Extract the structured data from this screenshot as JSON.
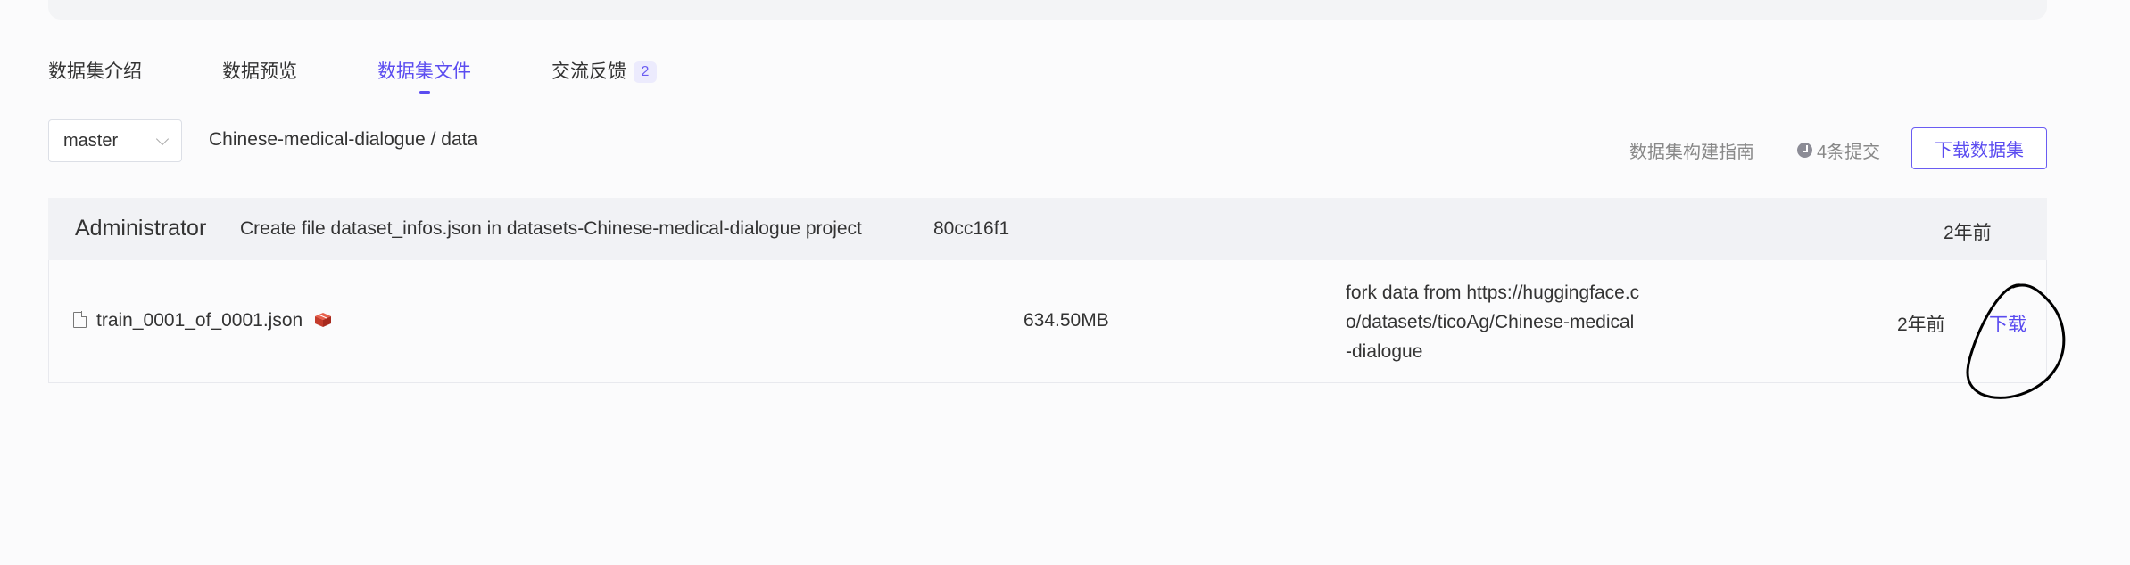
{
  "tabs": [
    {
      "label": "数据集介绍"
    },
    {
      "label": "数据预览"
    },
    {
      "label": "数据集文件",
      "active": true
    },
    {
      "label": "交流反馈",
      "badge": "2"
    }
  ],
  "branch": {
    "value": "master"
  },
  "path": "Chinese-medical-dialogue / data",
  "actions": {
    "guide_link": "数据集构建指南",
    "commits": "4条提交",
    "download_button": "下载数据集"
  },
  "last_commit": {
    "author": "Administrator",
    "message": "Create file dataset_infos.json in datasets-Chinese-medical-dialogue project",
    "hash": "80cc16f1",
    "time": "2年前"
  },
  "files": [
    {
      "name": "train_0001_of_0001.json",
      "size": "634.50MB",
      "message": "fork data from https://huggingface.co/datasets/ticoAg/Chinese-medical-dialogue",
      "time": "2年前",
      "download": "下载"
    }
  ],
  "colors": {
    "accent": "#5b4cf0",
    "badge_bg": "#ecebfd",
    "commit_bar_bg": "#f1f2f5"
  },
  "icons": {
    "file": "file-icon",
    "lfs": "lfs-icon",
    "clock": "clock-icon"
  }
}
